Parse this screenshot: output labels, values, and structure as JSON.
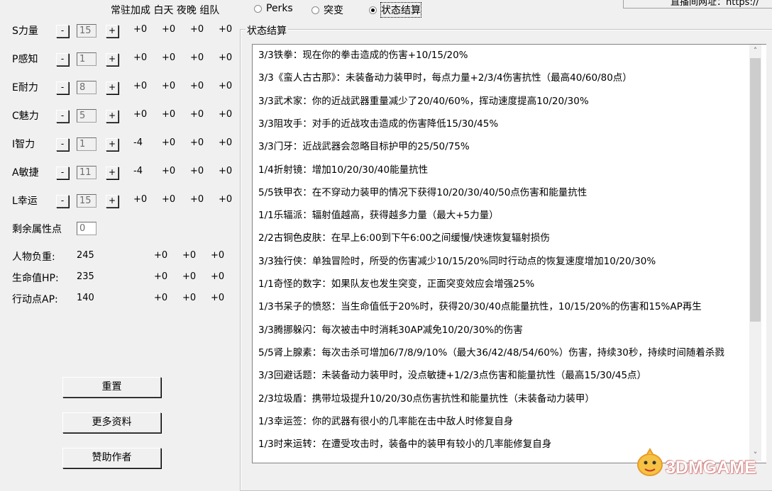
{
  "header": {
    "columns_label": "常驻加成 白天 夜晚 组队",
    "url_partial": "直播间网址：https://"
  },
  "tabs": [
    {
      "label": "Perks",
      "selected": false
    },
    {
      "label": "突变",
      "selected": false
    },
    {
      "label": "状态结算",
      "selected": true
    }
  ],
  "special": [
    {
      "label": "S力量",
      "value": "15",
      "mods": [
        "+0",
        "+0",
        "+0",
        "+0"
      ]
    },
    {
      "label": "P感知",
      "value": "1",
      "mods": [
        "+0",
        "+0",
        "+0",
        "+0"
      ]
    },
    {
      "label": "E耐力",
      "value": "8",
      "mods": [
        "+0",
        "+0",
        "+0",
        "+0"
      ]
    },
    {
      "label": "C魅力",
      "value": "5",
      "mods": [
        "+0",
        "+0",
        "+0",
        "+0"
      ]
    },
    {
      "label": "I智力",
      "value": "1",
      "mods": [
        "-4",
        "+0",
        "+0",
        "+0"
      ]
    },
    {
      "label": "A敏捷",
      "value": "11",
      "mods": [
        "-4",
        "+0",
        "+0",
        "+0"
      ]
    },
    {
      "label": "L幸运",
      "value": "15",
      "mods": [
        "+0",
        "+0",
        "+0",
        "+0"
      ]
    }
  ],
  "minus_label": "-",
  "plus_label": "+",
  "remaining": {
    "label": "剩余属性点",
    "value": "0"
  },
  "derived": [
    {
      "label": "人物负重:",
      "value": "245",
      "mods": [
        "+0",
        "+0",
        "+0"
      ]
    },
    {
      "label": "生命值HP:",
      "value": "235",
      "mods": [
        "+0",
        "+0",
        "+0"
      ]
    },
    {
      "label": "行动点AP:",
      "value": "140",
      "mods": [
        "+0",
        "+0",
        "+0"
      ]
    }
  ],
  "buttons": {
    "reset": "重置",
    "more_info": "更多资料",
    "support_author": "赞助作者"
  },
  "status_panel": {
    "title": "状态结算",
    "lines": [
      "3/3铁拳：现在你的拳击造成的伤害+10/15/20%",
      "3/3《蛮人古古那》：未装备动力装甲时，每点力量+2/3/4伤害抗性（最高40/60/80点）",
      "3/3武术家：你的近战武器重量减少了20/40/60%，挥动速度提高10/20/30%",
      "3/3阻攻手：对手的近战攻击造成的伤害降低15/30/45%",
      "3/3门牙：近战武器会忽略目标护甲的25/50/75%",
      "1/4折射镜：增加10/20/30/40能量抗性",
      "5/5铁甲衣：在不穿动力装甲的情况下获得10/20/30/40/50点伤害和能量抗性",
      "1/1乐辐派：辐射值越高，获得越多力量（最大+5力量）",
      "2/2古铜色皮肤：在早上6:00到下午6:00之间缓慢/快速恢复辐射损伤",
      "3/3独行侠：单独冒险时，所受的伤害减少10/15/20%同时行动点的恢复速度增加10/20/30%",
      "1/1奇怪的数字：如果队友也发生突变，正面突变效应会增强25%",
      "1/3书呆子的愤怒：当生命值低于20%时，获得20/30/40点能量抗性，10/15/20%的伤害和15%AP再生",
      "3/3腾挪躲闪：每次被击中时消耗30AP减免10/20/30%的伤害",
      "5/5肾上腺素：每次击杀可增加6/7/8/9/10%（最大36/42/48/54/60%）伤害，持续30秒，持续时间随着杀戮",
      "3/3回避话题：未装备动力装甲时，没点敏捷+1/2/3点伤害和能量抗性（最高15/30/45点）",
      "2/3垃圾盾：携带垃圾提升10/20/30点伤害抗性和能量抗性（未装备动力装甲）",
      "1/3幸运签：你的武器有很小的几率能在击中敌人时修复自身",
      "1/3时来运转：在遭受攻击时，装备中的装甲有较小的几率能修复自身"
    ]
  },
  "watermark": {
    "text": "3DMGAME"
  },
  "colors": {
    "window_bg": "#f0f0f0",
    "list_bg": "#ffffff",
    "border": "#828282"
  }
}
